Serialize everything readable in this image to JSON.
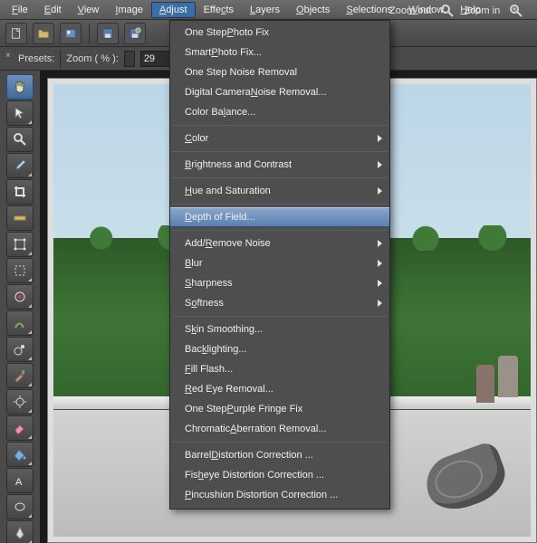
{
  "menubar": {
    "items": [
      {
        "label": "File",
        "u": 0
      },
      {
        "label": "Edit",
        "u": 0
      },
      {
        "label": "View",
        "u": 0
      },
      {
        "label": "Image",
        "u": 0
      },
      {
        "label": "Adjust",
        "u": 0,
        "active": true
      },
      {
        "label": "Effects",
        "u": 4
      },
      {
        "label": "Layers",
        "u": 0
      },
      {
        "label": "Objects",
        "u": 0
      },
      {
        "label": "Selections",
        "u": 0
      },
      {
        "label": "Window",
        "u": 0
      },
      {
        "label": "Help",
        "u": 0
      }
    ]
  },
  "toolbar": {
    "zoom_out_label": "Zoom out",
    "zoom_in_label": "Zoom in"
  },
  "optbar": {
    "presets_label": "Presets:",
    "zoom_label": "Zoom ( % ):",
    "zoom_value": "29"
  },
  "adjust_menu": {
    "groups": [
      [
        {
          "label": "One Step Photo Fix",
          "u": 9
        },
        {
          "label": "Smart Photo Fix...",
          "u": 6
        },
        {
          "label": "One Step Noise Removal",
          "u": 22
        },
        {
          "label": "Digital Camera Noise Removal...",
          "u": 15
        },
        {
          "label": "Color Balance...",
          "u": 8
        }
      ],
      [
        {
          "label": "Color",
          "u": 0,
          "sub": true
        }
      ],
      [
        {
          "label": "Brightness and Contrast",
          "u": 0,
          "sub": true
        }
      ],
      [
        {
          "label": "Hue and Saturation",
          "u": 0,
          "sub": true
        }
      ],
      [
        {
          "label": "Depth of Field...",
          "u": 0,
          "highlight": true
        }
      ],
      [
        {
          "label": "Add/Remove Noise",
          "u": 4,
          "sub": true
        },
        {
          "label": "Blur",
          "u": 0,
          "sub": true
        },
        {
          "label": "Sharpness",
          "u": 0,
          "sub": true
        },
        {
          "label": "Softness",
          "u": 1,
          "sub": true
        }
      ],
      [
        {
          "label": "Skin Smoothing...",
          "u": 1
        },
        {
          "label": "Backlighting...",
          "u": 3
        },
        {
          "label": "Fill Flash...",
          "u": 0
        },
        {
          "label": "Red Eye Removal...",
          "u": 0
        },
        {
          "label": "One Step Purple Fringe Fix",
          "u": 9
        },
        {
          "label": "Chromatic Aberration Removal...",
          "u": 10
        }
      ],
      [
        {
          "label": "Barrel Distortion Correction ...",
          "u": 7
        },
        {
          "label": "Fisheye Distortion Correction ...",
          "u": 3
        },
        {
          "label": "Pincushion Distortion Correction ...",
          "u": 0
        }
      ]
    ]
  }
}
